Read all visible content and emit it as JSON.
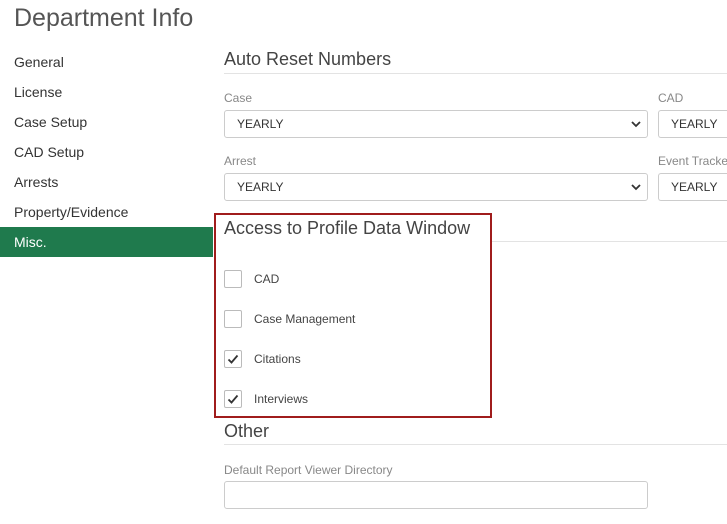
{
  "page": {
    "title": "Department Info"
  },
  "sidebar": {
    "items": [
      {
        "label": "General"
      },
      {
        "label": "License"
      },
      {
        "label": "Case Setup"
      },
      {
        "label": "CAD Setup"
      },
      {
        "label": "Arrests"
      },
      {
        "label": "Property/Evidence"
      },
      {
        "label": "Misc.",
        "active": true
      }
    ]
  },
  "auto_reset": {
    "title": "Auto Reset Numbers",
    "fields": [
      {
        "label": "Case",
        "value": "YEARLY"
      },
      {
        "label": "CAD",
        "value": "YEARLY"
      },
      {
        "label": "Arrest",
        "value": "YEARLY"
      },
      {
        "label": "Event Tracke",
        "value": "YEARLY"
      }
    ]
  },
  "access": {
    "title": "Access to Profile Data Window",
    "options": [
      {
        "label": "CAD",
        "checked": false
      },
      {
        "label": "Case Management",
        "checked": false
      },
      {
        "label": "Citations",
        "checked": true
      },
      {
        "label": "Interviews",
        "checked": true
      }
    ]
  },
  "other": {
    "title": "Other",
    "viewer_dir_label": "Default Report Viewer Directory",
    "viewer_dir_value": ""
  },
  "colors": {
    "accent": "#1f7a4d",
    "highlight_border": "#a01c1c"
  }
}
